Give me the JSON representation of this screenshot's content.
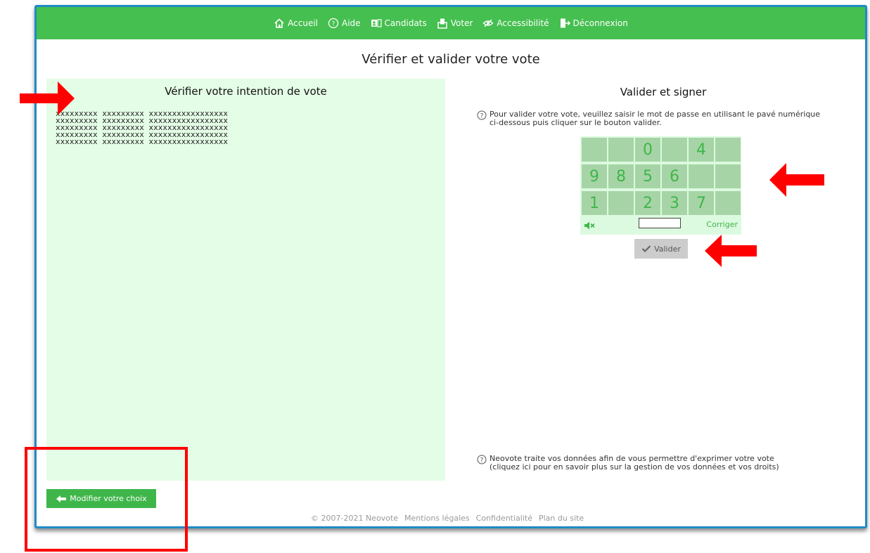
{
  "nav": {
    "items": [
      {
        "label": "Accueil",
        "icon": "home-icon"
      },
      {
        "label": "Aide",
        "icon": "help-icon"
      },
      {
        "label": "Candidats",
        "icon": "candidates-icon"
      },
      {
        "label": "Voter",
        "icon": "vote-icon"
      },
      {
        "label": "Accessibilité",
        "icon": "accessibility-icon"
      },
      {
        "label": "Déconnexion",
        "icon": "logout-icon"
      }
    ]
  },
  "page_title": "Vérifier et valider votre vote",
  "left_panel": {
    "title": "Vérifier votre intention de vote",
    "lines": [
      "xxxxxxxxx xxxxxxxxx xxxxxxxxxxxxxxxxx",
      "xxxxxxxxx xxxxxxxxx xxxxxxxxxxxxxxxxx",
      "xxxxxxxxx xxxxxxxxx xxxxxxxxxxxxxxxxx",
      "xxxxxxxxx xxxxxxxxx xxxxxxxxxxxxxxxxx",
      "xxxxxxxxx xxxxxxxxx xxxxxxxxxxxxxxxxx"
    ]
  },
  "right_panel": {
    "title": "Valider et signer",
    "instruction_line1": "Pour valider votre vote, veuillez saisir le mot de passe en utilisant le pavé numérique",
    "instruction_line2": "ci-dessous puis cliquer sur le bouton valider.",
    "keypad": {
      "row1": [
        "",
        "",
        "0",
        "",
        "4",
        ""
      ],
      "row2": [
        "9",
        "8",
        "5",
        "6",
        "",
        ""
      ],
      "row3": [
        "1",
        "",
        "2",
        "3",
        "7",
        ""
      ]
    },
    "password_value": "",
    "correct_label": "Corriger",
    "validate_label": "Valider",
    "privacy_line1": "Neovote traite vos données afin de vous permettre d'exprimer votre vote",
    "privacy_line2": "(cliquez ici pour en savoir plus sur la gestion de vos données et vos droits)"
  },
  "modify_label": "Modifier votre choix",
  "footer": {
    "copyright": "© 2007-2021 Neovote",
    "legal": "Mentions légales",
    "privacy": "Confidentialité",
    "sitemap": "Plan du site"
  },
  "colors": {
    "nav_green": "#45bf4f",
    "panel_green": "#e4fde6",
    "key_green": "#a7d4a7",
    "frame_blue": "#1f8bc7",
    "annotation_red": "#ff0000"
  }
}
